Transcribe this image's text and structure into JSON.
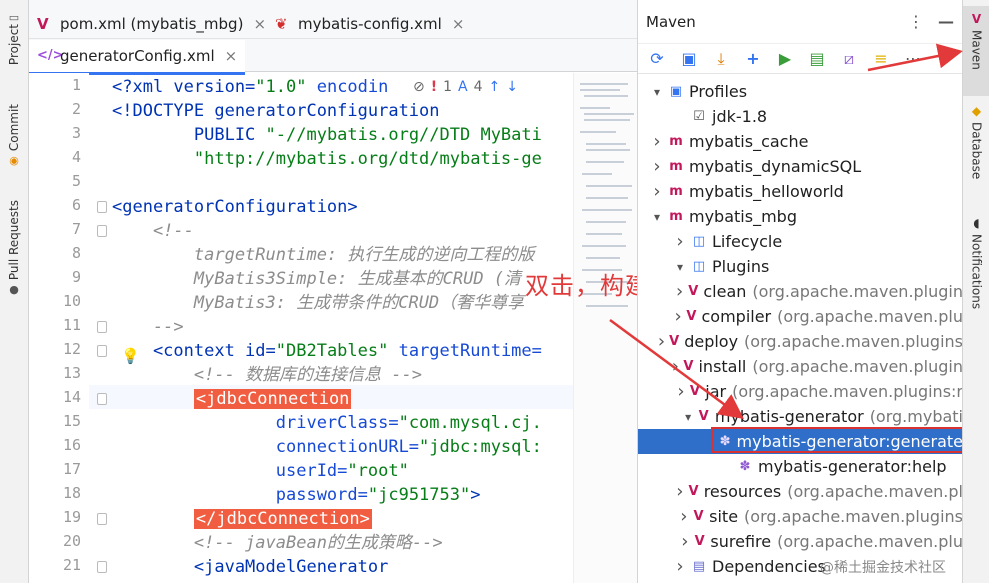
{
  "left_stripe": {
    "project": "Project",
    "commit": "Commit",
    "pull_requests": "Pull Requests"
  },
  "tabs": {
    "row1": [
      {
        "label": "pom.xml (mybatis_mbg)",
        "icon": "maven-icon"
      },
      {
        "label": "mybatis-config.xml",
        "icon": "mybatis-bird-icon"
      }
    ],
    "row2": [
      {
        "label": "generatorConfig.xml",
        "icon": "xml-file-icon"
      }
    ],
    "close": "×"
  },
  "editor": {
    "line_numbers": [
      "1",
      "2",
      "3",
      "4",
      "5",
      "6",
      "7",
      "8",
      "9",
      "10",
      "11",
      "12",
      "13",
      "14",
      "15",
      "16",
      "17",
      "18",
      "19",
      "20",
      "21"
    ],
    "code": {
      "l1a": "<?xml version=",
      "l1b": "\"1.0\"",
      "l1c": " encodin",
      "l2": "<!DOCTYPE generatorConfiguration",
      "l3a": "        PUBLIC ",
      "l3b": "\"-//mybatis.org//DTD MyBati",
      "l4": "        \"http://mybatis.org/dtd/mybatis-ge",
      "l6": "<generatorConfiguration>",
      "l7": "    <!--",
      "l8": "        targetRuntime: 执行生成的逆向工程的版",
      "l9": "        MyBatis3Simple: 生成基本的CRUD (清",
      "l10": "        MyBatis3: 生成带条件的CRUD（奢华尊享",
      "l11": "    -->",
      "l12a": "    <context id=",
      "l12b": "\"DB2Tables\"",
      "l12c": " targetRuntime=",
      "l13": "        <!-- 数据库的连接信息 -->",
      "l14": "<jdbcConnection",
      "l15a": "                driverClass=",
      "l15b": "\"com.mysql.cj.",
      "l16a": "                connectionURL=",
      "l16b": "\"jdbc:mysql:",
      "l17a": "                userId=",
      "l17b": "\"root\"",
      "l18a": "                password=",
      "l18b": "\"jc951753\"",
      "l18c": ">",
      "l19": "</jdbcConnection>",
      "l20": "        <!-- javaBean的生成策略-->",
      "l21": "        <javaModelGenerator"
    },
    "inspections": {
      "errors": "1",
      "warnings": "4"
    }
  },
  "annotation": "双击，构建逆向工程",
  "maven": {
    "title": "Maven",
    "more": "⋮",
    "minimize": "—",
    "toolbar": [
      "reload-icon",
      "add-folder-icon",
      "download-icon",
      "plus-icon",
      "run-icon",
      "execute-goal-icon",
      "skip-tests-icon",
      "show-dependencies-icon",
      "collapse-icon"
    ],
    "tree": [
      {
        "label": "Profiles",
        "sub": "",
        "depth": 0,
        "arrow": "expanded",
        "icon": "profiles-icon"
      },
      {
        "label": "jdk-1.8",
        "sub": "",
        "depth": 1,
        "arrow": "none",
        "icon": "checkbox-icon"
      },
      {
        "label": "mybatis_cache",
        "sub": "",
        "depth": 0,
        "arrow": "collapsed",
        "icon": "maven-module-icon"
      },
      {
        "label": "mybatis_dynamicSQL",
        "sub": "",
        "depth": 0,
        "arrow": "collapsed",
        "icon": "maven-module-icon"
      },
      {
        "label": "mybatis_helloworld",
        "sub": "",
        "depth": 0,
        "arrow": "collapsed",
        "icon": "maven-module-icon"
      },
      {
        "label": "mybatis_mbg",
        "sub": "",
        "depth": 0,
        "arrow": "expanded",
        "icon": "maven-module-icon"
      },
      {
        "label": "Lifecycle",
        "sub": "",
        "depth": 1,
        "arrow": "collapsed",
        "icon": "lifecycle-icon"
      },
      {
        "label": "Plugins",
        "sub": "",
        "depth": 1,
        "arrow": "expanded",
        "icon": "plugins-icon"
      },
      {
        "label": "clean",
        "sub": "(org.apache.maven.plugin",
        "depth": 2,
        "arrow": "collapsed",
        "icon": "plugin-icon"
      },
      {
        "label": "compiler",
        "sub": "(org.apache.maven.plu",
        "depth": 2,
        "arrow": "collapsed",
        "icon": "plugin-icon"
      },
      {
        "label": "deploy",
        "sub": "(org.apache.maven.plugins",
        "depth": 2,
        "arrow": "collapsed",
        "icon": "plugin-icon"
      },
      {
        "label": "install",
        "sub": "(org.apache.maven.plugin",
        "depth": 2,
        "arrow": "collapsed",
        "icon": "plugin-icon"
      },
      {
        "label": "jar",
        "sub": "(org.apache.maven.plugins:r",
        "depth": 2,
        "arrow": "collapsed",
        "icon": "plugin-icon"
      },
      {
        "label": "mybatis-generator",
        "sub": "(org.mybati",
        "depth": 2,
        "arrow": "expanded",
        "icon": "plugin-icon"
      },
      {
        "label": "mybatis-generator:generate",
        "sub": "",
        "depth": 3,
        "arrow": "none",
        "icon": "goal-icon",
        "selected": true
      },
      {
        "label": "mybatis-generator:help",
        "sub": "",
        "depth": 3,
        "arrow": "none",
        "icon": "goal-icon"
      },
      {
        "label": "resources",
        "sub": "(org.apache.maven.pl",
        "depth": 2,
        "arrow": "collapsed",
        "icon": "plugin-icon"
      },
      {
        "label": "site",
        "sub": "(org.apache.maven.plugins",
        "depth": 2,
        "arrow": "collapsed",
        "icon": "plugin-icon"
      },
      {
        "label": "surefire",
        "sub": "(org.apache.maven.plu",
        "depth": 2,
        "arrow": "collapsed",
        "icon": "plugin-icon"
      },
      {
        "label": "Dependencies",
        "sub": "",
        "depth": 1,
        "arrow": "collapsed",
        "icon": "dependencies-icon"
      }
    ]
  },
  "right_stripe": {
    "maven": "Maven",
    "database": "Database",
    "notifications": "Notifications"
  },
  "watermark": "@稀土掘金技术社区",
  "colors": {
    "selection": "#2f6fc9",
    "annotation": "#e23a3a",
    "accent": "#3574f0",
    "maven": "#c2185b"
  }
}
